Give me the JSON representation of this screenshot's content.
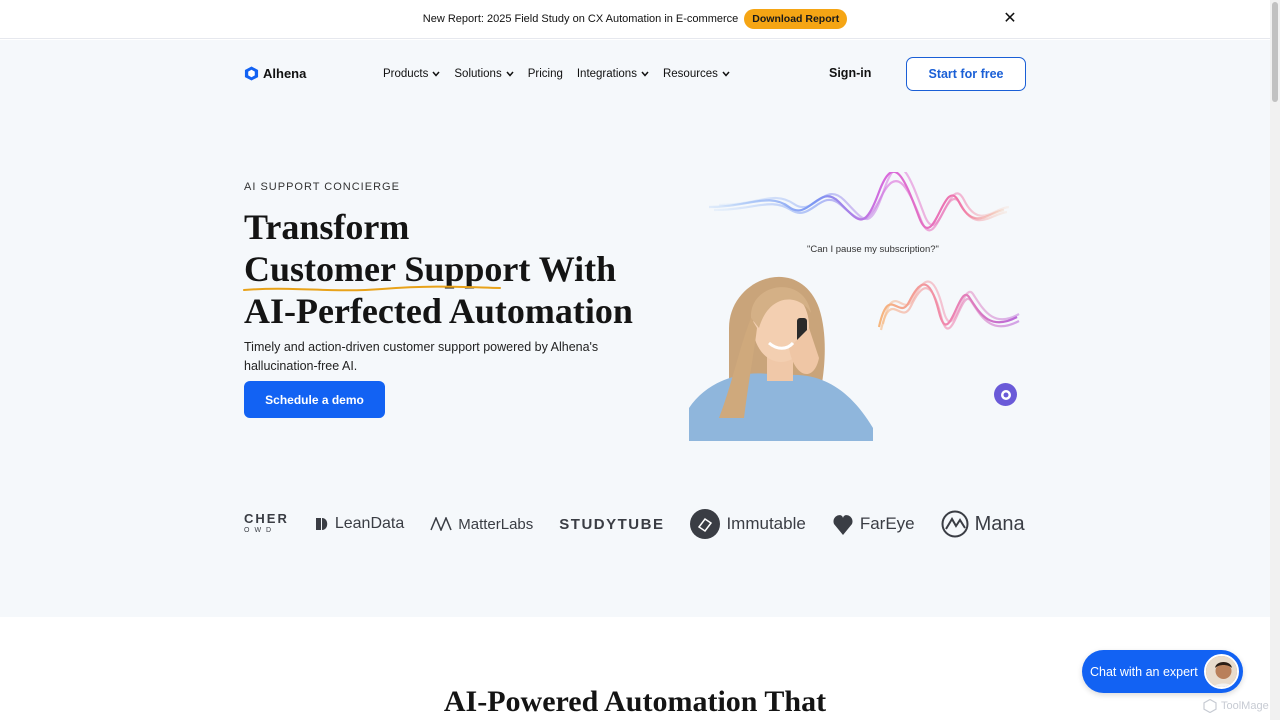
{
  "announcement": {
    "text": "New Report: 2025 Field Study on CX Automation in E-commerce",
    "button_label": "Download Report",
    "close_glyph": "✕"
  },
  "header": {
    "brand": "Alhena",
    "nav": [
      {
        "label": "Products",
        "has_dropdown": true
      },
      {
        "label": "Solutions",
        "has_dropdown": true
      },
      {
        "label": "Pricing",
        "has_dropdown": false
      },
      {
        "label": "Integrations",
        "has_dropdown": true
      },
      {
        "label": "Resources",
        "has_dropdown": true
      }
    ],
    "signin_label": "Sign-in",
    "cta_label": "Start for free"
  },
  "hero": {
    "eyebrow": "AI SUPPORT CONCIERGE",
    "headline_pre": "Transform ",
    "headline_emph": "Customer Support",
    "headline_post": " With AI-Perfected Automation",
    "subtext": "Timely and action-driven customer support powered by Alhena's hallucination-free AI.",
    "demo_label": "Schedule a demo",
    "quote": "\"Can I pause my subscription?\""
  },
  "logos": {
    "cher_top": "CHER",
    "cher_bottom": "OWD",
    "leandata": "LeanData",
    "matterlabs": "MatterLabs",
    "studytube": "STUDYTUBE",
    "immutable": "Immutable",
    "fareye": "FarEye",
    "mana": "Mana"
  },
  "section2": {
    "title": "AI-Powered Automation That"
  },
  "chat": {
    "label": "Chat with an expert"
  },
  "watermark": {
    "text": "ToolMage"
  },
  "colors": {
    "primary": "#1262f3",
    "accent_orange": "#f5a514",
    "hero_bg": "#f5f8fb",
    "squiggle": "#e8a21a"
  }
}
